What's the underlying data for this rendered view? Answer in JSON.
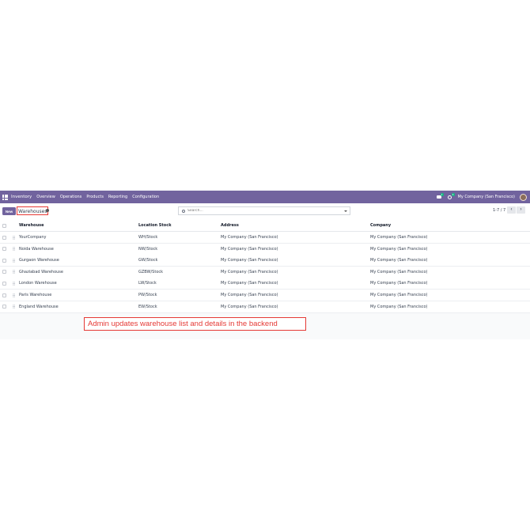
{
  "topbar": {
    "app_name": "Inventory",
    "menu": [
      "Overview",
      "Operations",
      "Products",
      "Reporting",
      "Configuration"
    ],
    "chat_badge": "7",
    "activity_badge": "3",
    "company": "My Company (San Francisco)"
  },
  "control": {
    "new_label": "New",
    "title": "Warehouses",
    "search_placeholder": "Search...",
    "pager": "1-7 / 7"
  },
  "table": {
    "columns": [
      "Warehouse",
      "Location Stock",
      "Address",
      "Company"
    ],
    "rows": [
      [
        "YourCompany",
        "WH/Stock",
        "My Company (San Francisco)",
        "My Company (San Francisco)"
      ],
      [
        "Noida Warehouse",
        "NW/Stock",
        "My Company (San Francisco)",
        "My Company (San Francisco)"
      ],
      [
        "Gurgaon Warehouse",
        "GW/Stock",
        "My Company (San Francisco)",
        "My Company (San Francisco)"
      ],
      [
        "Ghaziabad Warehouse",
        "GZBW/Stock",
        "My Company (San Francisco)",
        "My Company (San Francisco)"
      ],
      [
        "London Warehouse",
        "LW/Stock",
        "My Company (San Francisco)",
        "My Company (San Francisco)"
      ],
      [
        "Paris Warehouse",
        "PW/Stock",
        "My Company (San Francisco)",
        "My Company (San Francisco)"
      ],
      [
        "England Warehouse",
        "EW/Stock",
        "My Company (San Francisco)",
        "My Company (San Francisco)"
      ]
    ]
  },
  "annotation": "Admin updates warehouse list and details in the backend",
  "colors": {
    "brand": "#71639e",
    "annotation": "#e53935"
  }
}
